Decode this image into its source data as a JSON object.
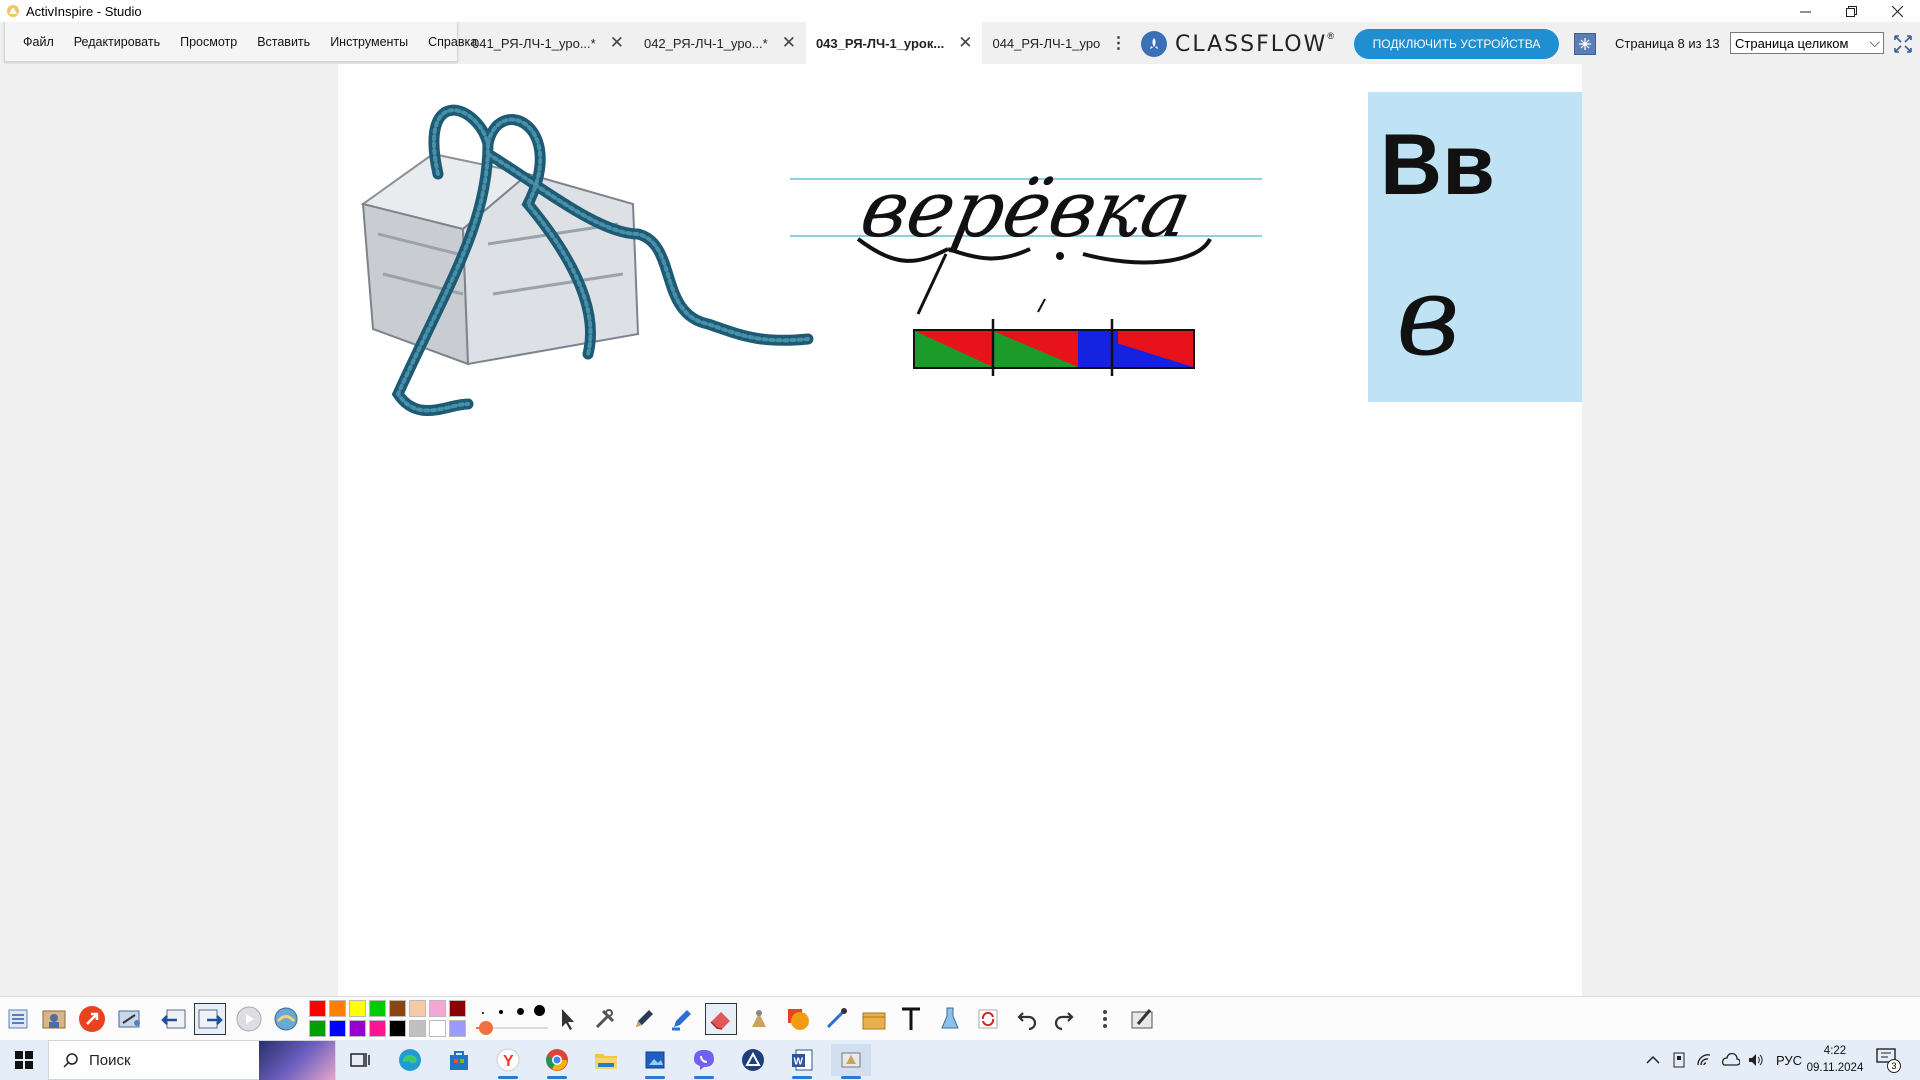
{
  "window": {
    "title": "ActivInspire - Studio"
  },
  "menu": {
    "items": [
      "Файл",
      "Редактировать",
      "Просмотр",
      "Вставить",
      "Инструменты",
      "Справка"
    ]
  },
  "tabs": [
    {
      "label": "041_РЯ-ЛЧ-1_уро...*",
      "active": false,
      "closable": true
    },
    {
      "label": "042_РЯ-ЛЧ-1_уро...*",
      "active": false,
      "closable": true
    },
    {
      "label": "043_РЯ-ЛЧ-1_урок...",
      "active": true,
      "closable": true
    },
    {
      "label": "044_РЯ-ЛЧ-1_уро",
      "active": false,
      "closable": false
    }
  ],
  "classflow": {
    "brand": "CLASSFLOW",
    "trademark": "®",
    "connect_label": "ПОДКЛЮЧИТЬ УСТРОЙСТВА"
  },
  "pager": {
    "counter": "Страница 8 из 13",
    "zoom_value": "Страница целиком"
  },
  "flipchart": {
    "word": "верёвка",
    "letter_print": "Вв",
    "letter_script": "в",
    "scheme_colors": [
      "#1a9b2a",
      "#e8121a",
      "#1522e0"
    ]
  },
  "palette": {
    "colors": [
      "#ff0000",
      "#ff8000",
      "#ffff00",
      "#00cc00",
      "#8b4513",
      "#f5cba7",
      "#f4a6d7",
      "#8b0000",
      "#00a000",
      "#0000ff",
      "#9900cc",
      "#ff1493",
      "#000000",
      "#c0c0c0",
      "#ffffff",
      "#9a9aff"
    ]
  },
  "taskbar": {
    "search_placeholder": "Поиск",
    "language": "РУС",
    "time": "4:22",
    "date": "09.11.2024",
    "notifications": "3"
  }
}
